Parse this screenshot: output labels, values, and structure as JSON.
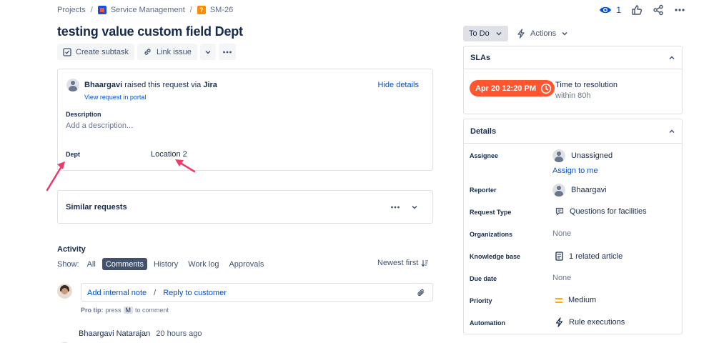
{
  "breadcrumb": {
    "projects": "Projects",
    "project": "Service Management",
    "issue_key": "SM-26",
    "separator": "/"
  },
  "header_actions": {
    "watch_count": "1",
    "icons": [
      "eye-icon",
      "thumbs-up-icon",
      "share-icon",
      "more-icon"
    ]
  },
  "issue": {
    "title": "testing value custom field Dept"
  },
  "toolbar": {
    "create_subtask": "Create subtask",
    "link_issue": "Link issue"
  },
  "request": {
    "reporter": "Bhaargavi",
    "raised_text": "raised this request via",
    "channel": "Jira",
    "view_portal": "View request in portal",
    "hide_details": "Hide details",
    "description_label": "Description",
    "description_placeholder": "Add a description...",
    "dept_label": "Dept",
    "dept_value": "Location 2"
  },
  "similar": {
    "title": "Similar requests"
  },
  "activity": {
    "title": "Activity",
    "show_label": "Show:",
    "tabs": [
      "All",
      "Comments",
      "History",
      "Work log",
      "Approvals"
    ],
    "active_tab": "Comments",
    "sort": "Newest first",
    "add_internal_note": "Add internal note",
    "slash": "/",
    "reply_to_customer": "Reply to customer",
    "pro_tip_label": "Pro tip:",
    "pro_tip_press": "press",
    "pro_tip_key": "M",
    "pro_tip_suffix": "to comment",
    "entry_author": "Bhaargavi Natarajan",
    "entry_time": "20 hours ago"
  },
  "status": {
    "label": "To Do",
    "actions": "Actions"
  },
  "sla": {
    "title": "SLAs",
    "badge": "Apr 20 12:20 PM",
    "metric": "Time to resolution",
    "target": "within 80h"
  },
  "details": {
    "title": "Details",
    "assignee_label": "Assignee",
    "assignee_value": "Unassigned",
    "assign_to_me": "Assign to me",
    "reporter_label": "Reporter",
    "reporter_value": "Bhaargavi",
    "request_type_label": "Request Type",
    "request_type_value": "Questions for facilities",
    "organizations_label": "Organizations",
    "organizations_value": "None",
    "knowledge_label": "Knowledge base",
    "knowledge_value": "1 related article",
    "due_label": "Due date",
    "due_value": "None",
    "priority_label": "Priority",
    "priority_value": "Medium",
    "automation_label": "Automation",
    "automation_value": "Rule executions"
  },
  "colors": {
    "link": "#0052cc",
    "sla_breach": "#ff5630",
    "annotation_arrow": "#f0386b",
    "priority_medium": "#ffab00"
  }
}
